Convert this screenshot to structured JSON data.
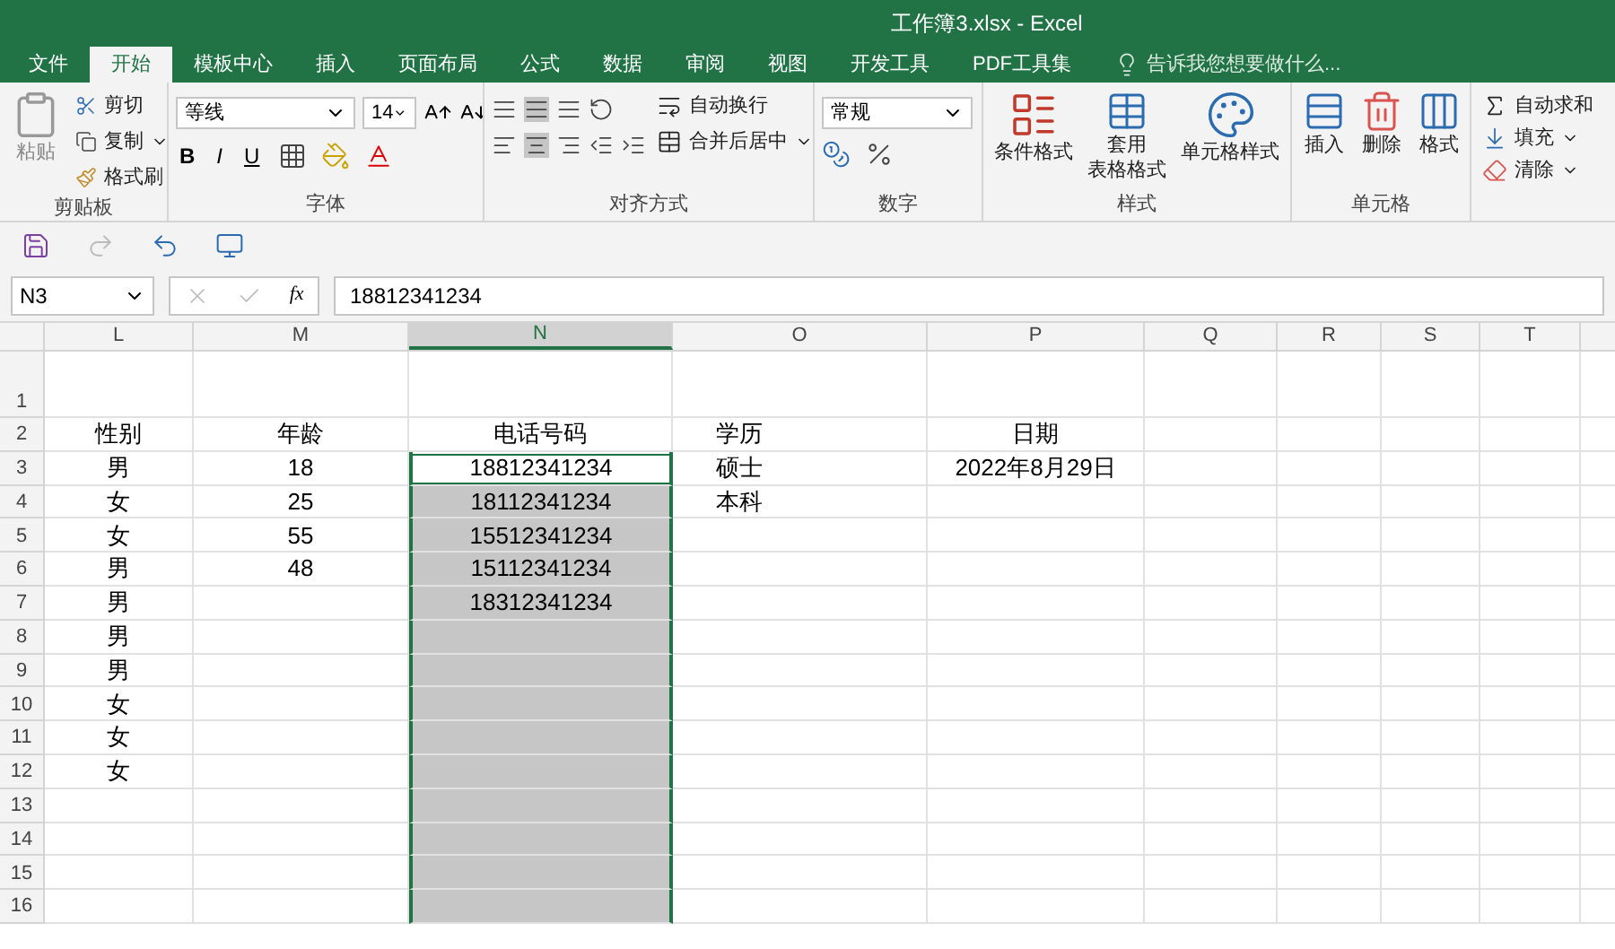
{
  "window": {
    "title": "工作簿3.xlsx - Excel"
  },
  "tabs": [
    {
      "label": "文件",
      "selected": false
    },
    {
      "label": "开始",
      "selected": true
    },
    {
      "label": "模板中心",
      "selected": false
    },
    {
      "label": "插入",
      "selected": false
    },
    {
      "label": "页面布局",
      "selected": false
    },
    {
      "label": "公式",
      "selected": false
    },
    {
      "label": "数据",
      "selected": false
    },
    {
      "label": "审阅",
      "selected": false
    },
    {
      "label": "视图",
      "selected": false
    },
    {
      "label": "开发工具",
      "selected": false
    },
    {
      "label": "PDF工具集",
      "selected": false
    }
  ],
  "tell_me": {
    "placeholder": "告诉我您想要做什么..."
  },
  "ribbon": {
    "clipboard": {
      "label": "剪贴板",
      "paste": "粘贴",
      "cut": "剪切",
      "copy": "复制",
      "format_painter": "格式刷"
    },
    "font": {
      "label": "字体",
      "font_name": "等线",
      "font_size": "14",
      "bold": "B",
      "italic": "I",
      "underline": "U"
    },
    "alignment": {
      "label": "对齐方式",
      "wrap_text": "自动换行",
      "merge_center": "合并后居中"
    },
    "number": {
      "label": "数字",
      "format": "常规"
    },
    "styles": {
      "label": "样式",
      "conditional": "条件格式",
      "table_format": [
        "套用",
        "表格格式"
      ],
      "cell_styles": "单元格样式"
    },
    "cells": {
      "label": "单元格",
      "insert": "插入",
      "delete": "删除",
      "format": "格式"
    },
    "editing": {
      "autosum": "自动求和",
      "fill": "填充",
      "clear": "清除"
    }
  },
  "name_box": "N3",
  "function_label": "fx",
  "formula": "18812341234",
  "columns": [
    {
      "label": "L",
      "selected": false
    },
    {
      "label": "M",
      "selected": false
    },
    {
      "label": "N",
      "selected": true
    },
    {
      "label": "O",
      "selected": false
    },
    {
      "label": "P",
      "selected": false
    },
    {
      "label": "Q",
      "selected": false
    },
    {
      "label": "R",
      "selected": false
    },
    {
      "label": "S",
      "selected": false
    },
    {
      "label": "T",
      "selected": false
    }
  ],
  "rows": [
    {
      "number": "1",
      "selected": false,
      "active": false
    },
    {
      "number": "2",
      "gender": "性别",
      "age": "年龄",
      "phone": "电话号码",
      "education": "学历",
      "date": "日期",
      "selected": false,
      "active": false
    },
    {
      "number": "3",
      "gender": "男",
      "age": "18",
      "phone": "18812341234",
      "education": "硕士",
      "date": "2022年8月29日",
      "selected": true,
      "active": true
    },
    {
      "number": "4",
      "gender": "女",
      "age": "25",
      "phone": "18112341234",
      "education": "本科",
      "selected": true,
      "active": false
    },
    {
      "number": "5",
      "gender": "女",
      "age": "55",
      "phone": "15512341234",
      "selected": true,
      "active": false
    },
    {
      "number": "6",
      "gender": "男",
      "age": "48",
      "phone": "15112341234",
      "selected": true,
      "active": false
    },
    {
      "number": "7",
      "gender": "男",
      "phone": "18312341234",
      "selected": true,
      "active": false
    },
    {
      "number": "8",
      "gender": "男",
      "selected": true,
      "active": false
    },
    {
      "number": "9",
      "gender": "男",
      "selected": true,
      "active": false
    },
    {
      "number": "10",
      "gender": "女",
      "selected": true,
      "active": false
    },
    {
      "number": "11",
      "gender": "女",
      "selected": true,
      "active": false
    },
    {
      "number": "12",
      "gender": "女",
      "selected": true,
      "active": false
    },
    {
      "number": "13",
      "selected": true,
      "active": false
    },
    {
      "number": "14",
      "selected": true,
      "active": false
    },
    {
      "number": "15",
      "selected": true,
      "active": false
    },
    {
      "number": "16",
      "selected": true,
      "active": false
    }
  ]
}
